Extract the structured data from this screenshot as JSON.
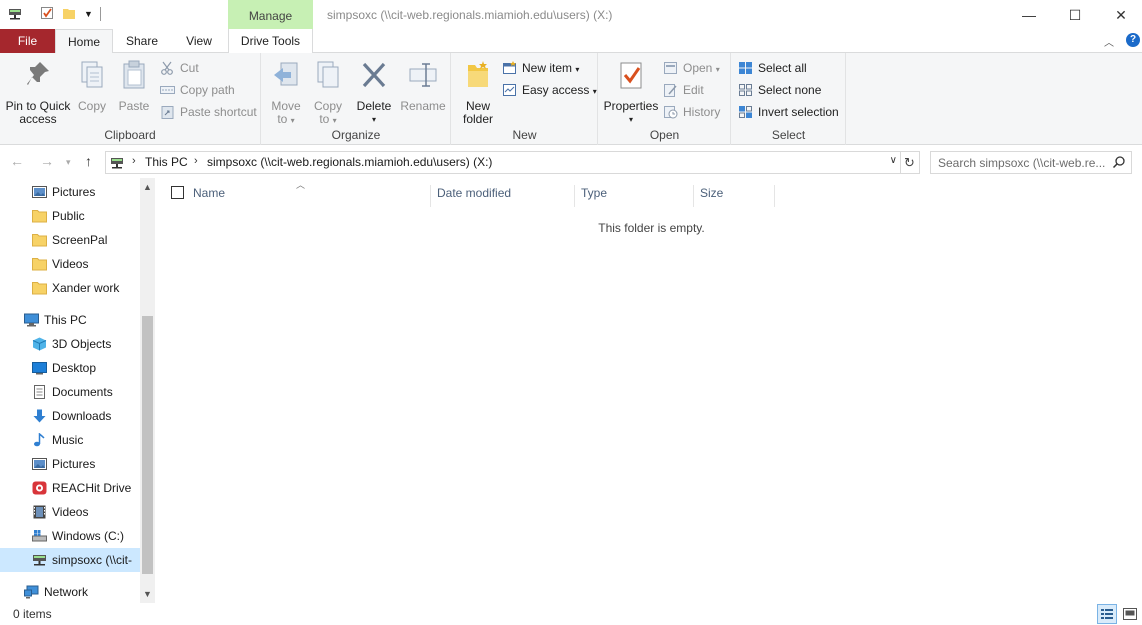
{
  "titlebar": {
    "manage_tab": "Manage",
    "window_title": "simpsoxc (\\\\cit-web.regionals.miamioh.edu\\users) (X:)",
    "minimize": "—",
    "maximize": "☐",
    "close": "✕"
  },
  "ribbon_tabs": {
    "file": "File",
    "home": "Home",
    "share": "Share",
    "view": "View",
    "drive_tools": "Drive Tools"
  },
  "ribbon": {
    "clipboard": {
      "label": "Clipboard",
      "pin_line1": "Pin to Quick",
      "pin_line2": "access",
      "copy": "Copy",
      "paste": "Paste",
      "cut": "Cut",
      "copy_path": "Copy path",
      "paste_shortcut": "Paste shortcut"
    },
    "organize": {
      "label": "Organize",
      "move_to_line1": "Move",
      "move_to_line2": "to",
      "copy_to_line1": "Copy",
      "copy_to_line2": "to",
      "delete": "Delete",
      "rename": "Rename"
    },
    "new": {
      "label": "New",
      "new_folder_line1": "New",
      "new_folder_line2": "folder",
      "new_item": "New item",
      "easy_access": "Easy access"
    },
    "open": {
      "label": "Open",
      "properties": "Properties",
      "open": "Open",
      "edit": "Edit",
      "history": "History"
    },
    "select": {
      "label": "Select",
      "select_all": "Select all",
      "select_none": "Select none",
      "invert_selection": "Invert selection"
    }
  },
  "address": {
    "crumbs": [
      "This PC",
      "simpsoxc (\\\\cit-web.regionals.miamioh.edu\\users) (X:)"
    ],
    "search_placeholder": "Search simpsoxc (\\\\cit-web.re..."
  },
  "navpane": {
    "items": [
      {
        "label": "Pictures",
        "icon": "pictures-icon"
      },
      {
        "label": "Public",
        "icon": "folder-icon"
      },
      {
        "label": "ScreenPal",
        "icon": "folder-icon"
      },
      {
        "label": "Videos",
        "icon": "folder-icon"
      },
      {
        "label": "Xander work",
        "icon": "folder-icon"
      },
      {
        "label": "This PC",
        "icon": "this-pc-icon"
      },
      {
        "label": "3D Objects",
        "icon": "3d-objects-icon"
      },
      {
        "label": "Desktop",
        "icon": "desktop-icon"
      },
      {
        "label": "Documents",
        "icon": "documents-icon"
      },
      {
        "label": "Downloads",
        "icon": "downloads-icon"
      },
      {
        "label": "Music",
        "icon": "music-icon"
      },
      {
        "label": "Pictures",
        "icon": "pictures-icon"
      },
      {
        "label": "REACHit Drive",
        "icon": "reachit-icon"
      },
      {
        "label": "Videos",
        "icon": "videos-icon"
      },
      {
        "label": "Windows (C:)",
        "icon": "drive-icon"
      },
      {
        "label": "simpsoxc (\\\\cit-",
        "icon": "network-drive-icon"
      },
      {
        "label": "Network",
        "icon": "network-icon"
      }
    ]
  },
  "filelist": {
    "columns": [
      "Name",
      "Date modified",
      "Type",
      "Size"
    ],
    "empty_message": "This folder is empty."
  },
  "status": {
    "item_count": "0 items"
  },
  "colors": {
    "file_tab": "#a5272d",
    "manage_tab": "#c7f0b4",
    "selection": "#cce8ff",
    "accent": "#1b6ac9"
  }
}
